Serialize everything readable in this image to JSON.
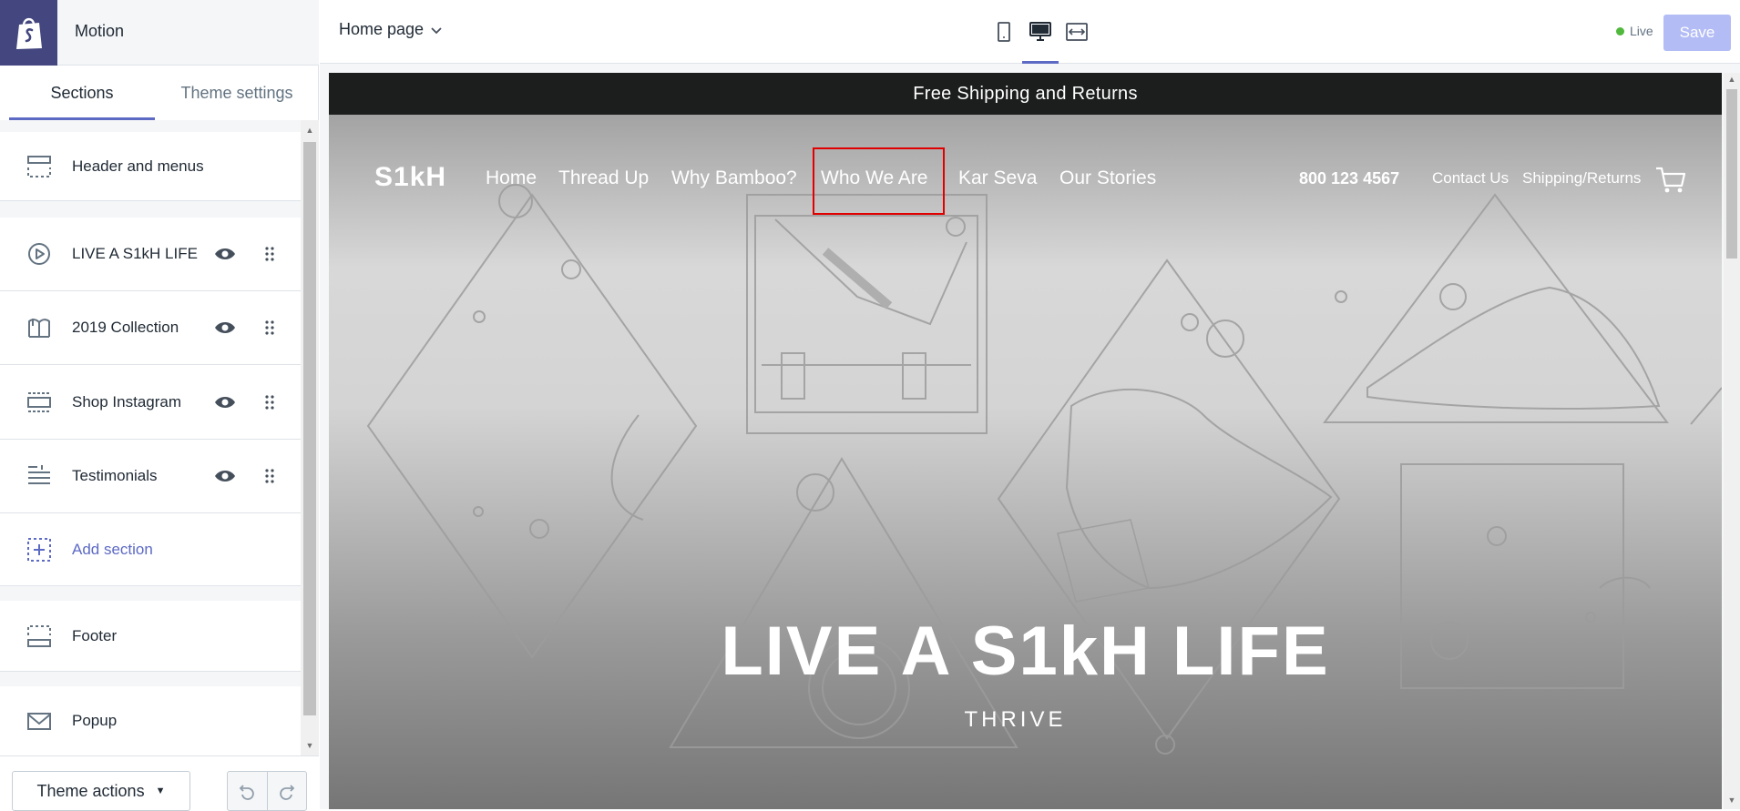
{
  "app": {
    "theme_name": "Motion"
  },
  "tabs": [
    {
      "label": "Sections",
      "active": true
    },
    {
      "label": "Theme settings",
      "active": false
    }
  ],
  "sections": [
    {
      "label": "Header and menus",
      "icon": "header-icon"
    },
    {
      "label": "LIVE A S1kH LIFE",
      "icon": "play-circle-icon",
      "visible": true
    },
    {
      "label": "2019 Collection",
      "icon": "book-icon",
      "visible": true
    },
    {
      "label": "Shop Instagram",
      "icon": "gallery-icon",
      "visible": true
    },
    {
      "label": "Testimonials",
      "icon": "text-lines-icon",
      "visible": true
    },
    {
      "label": "Add section",
      "icon": "add-section-icon"
    },
    {
      "label": "Footer",
      "icon": "footer-icon"
    },
    {
      "label": "Popup",
      "icon": "mail-icon"
    }
  ],
  "footer": {
    "theme_actions": "Theme actions"
  },
  "topbar": {
    "page_select": "Home page",
    "live_label": "Live",
    "save_label": "Save",
    "devices": [
      "mobile-icon",
      "desktop-icon",
      "fullwidth-icon"
    ],
    "active_device": "desktop-icon"
  },
  "preview": {
    "announcement": "Free Shipping and Returns",
    "site_logo": "S1kH",
    "nav_links": [
      "Home",
      "Thread Up",
      "Why Bamboo?",
      "Who We Are",
      "Kar Seva",
      "Our Stories"
    ],
    "phone": "800 123 4567",
    "contact": "Contact Us",
    "shipping": "Shipping/Returns",
    "hero_title": "LIVE A S1kH LIFE",
    "hero_subtitle": "THRIVE"
  },
  "colors": {
    "accent": "#5c6ac4",
    "brand_sidebar": "#43467f",
    "live_dot": "#50b83c",
    "save_disabled": "#b3bcf5",
    "highlight_box": "#e00000"
  }
}
